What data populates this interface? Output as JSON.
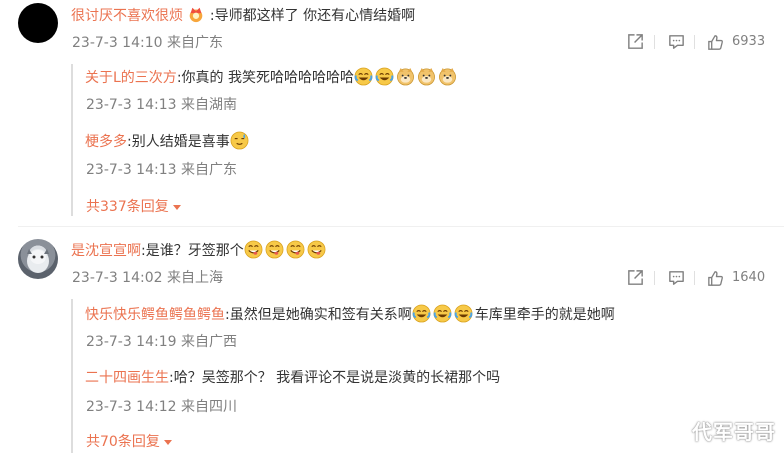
{
  "comment1": {
    "username": "很讨厌不喜欢很烦",
    "text": ":导师都这样了 你还有心情结婚啊",
    "time": "23-7-3 14:10 来自广东",
    "likes": "6933",
    "replies": [
      {
        "username": "关于L的三次方",
        "text": ":你真的 我笑死哈哈哈哈哈哈",
        "time": "23-7-3 14:13 来自湖南"
      },
      {
        "username": "梗多多",
        "text": ":别人结婚是喜事",
        "time": "23-7-3 14:13 来自广东"
      }
    ],
    "more_replies": "共337条回复"
  },
  "comment2": {
    "username": "是沈宣宣啊",
    "text": ":是谁？牙签那个",
    "time": "23-7-3 14:02 来自上海",
    "likes": "1640",
    "replies": [
      {
        "username": "快乐快乐鳄鱼鳄鱼鳄鱼",
        "text": ":虽然但是她确实和签有关系啊",
        "text_after": "车库里牵手的就是她啊",
        "time": "23-7-3 14:19 来自广西"
      },
      {
        "username": "二十四画生生",
        "text": ":哈？吴签那个？ 我看评论不是说是淡黄的长裙那个吗",
        "time": "23-7-3 14:12 来自四川"
      }
    ],
    "more_replies": "共70条回复"
  },
  "watermark": "代军哥哥",
  "colors": {
    "username": "#eb7350",
    "meta": "#808080",
    "text": "#333333"
  },
  "icons": [
    "forward-icon",
    "comment-icon",
    "like-icon",
    "crown-badge-icon",
    "laugh-cry-emoji",
    "doge-emoji",
    "sweat-emoji",
    "yum-emoji"
  ]
}
